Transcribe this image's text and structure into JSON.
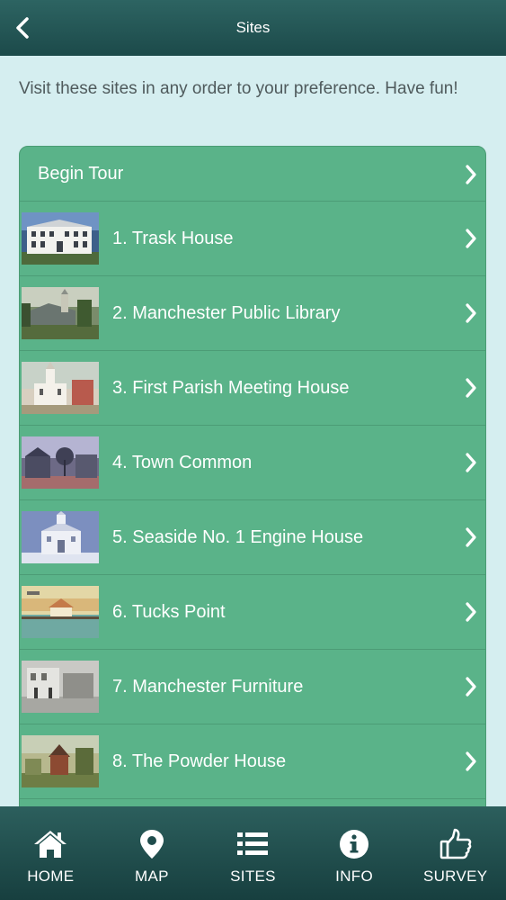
{
  "header": {
    "title": "Sites",
    "back_icon": "chevron-left-icon"
  },
  "intro": "Visit these sites in any order to your preference. Have fun!",
  "begin_tour": "Begin Tour",
  "sites": [
    {
      "label": "1. Trask House",
      "thumb": "photo-trask-house"
    },
    {
      "label": "2. Manchester Public Library",
      "thumb": "photo-library"
    },
    {
      "label": "3. First Parish Meeting House",
      "thumb": "photo-meeting-house"
    },
    {
      "label": "4. Town Common",
      "thumb": "photo-town-common"
    },
    {
      "label": "5. Seaside No. 1 Engine House",
      "thumb": "photo-engine-house"
    },
    {
      "label": "6. Tucks Point",
      "thumb": "photo-tucks-point"
    },
    {
      "label": "7. Manchester Furniture",
      "thumb": "photo-furniture"
    },
    {
      "label": "8. The Powder House",
      "thumb": "photo-powder-house"
    }
  ],
  "tabs": [
    {
      "label": "HOME",
      "icon": "home-icon"
    },
    {
      "label": "MAP",
      "icon": "map-pin-icon"
    },
    {
      "label": "SITES",
      "icon": "list-icon"
    },
    {
      "label": "INFO",
      "icon": "info-icon"
    },
    {
      "label": "SURVEY",
      "icon": "thumbs-up-icon"
    }
  ],
  "colors": {
    "header": "#1f4f4f",
    "background": "#d5eef0",
    "list": "#5ab389",
    "tabbar": "#1f4c4c"
  }
}
